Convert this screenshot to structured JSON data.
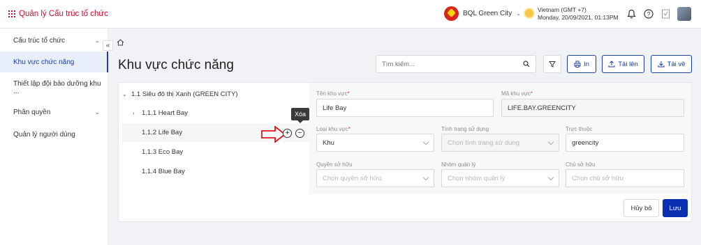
{
  "header": {
    "app_title": "Quản lý Cấu trúc tổ chức",
    "org_name": "BQL Green City",
    "timezone": "Vietnam (GMT +7)",
    "datetime": "Monday, 20/09/2021, 01:13PM"
  },
  "sidebar": {
    "items": [
      {
        "label": "Cấu trúc tổ chức",
        "has_chevron": true
      },
      {
        "label": "Khu vực chức năng",
        "active": true
      },
      {
        "label": "Thiết lập đội bảo dưỡng khu ..."
      },
      {
        "label": "Phân quyền",
        "has_chevron": true
      },
      {
        "label": "Quản lý người dùng"
      }
    ]
  },
  "main": {
    "page_title": "Khu vực chức năng",
    "search_placeholder": "Tìm kiếm...",
    "buttons": {
      "print": "In",
      "upload": "Tải lên",
      "download": "Tải về"
    }
  },
  "tree": {
    "root": "1.1 Siêu đô thị Xanh (GREEN CITY)",
    "children": [
      {
        "label": "1.1.1 Heart Bay",
        "expandable": true
      },
      {
        "label": "1.1.2 Life Bay",
        "selected": true
      },
      {
        "label": "1.1.3 Eco Bay"
      },
      {
        "label": "1.1.4 Blue Bay"
      }
    ],
    "tooltip": "Xóa"
  },
  "form": {
    "name_label": "Tên khu vực",
    "name_value": "Life Bay",
    "code_label": "Mã khu vực",
    "code_value": "LIFE.BAY.GREENCITY",
    "type_label": "Loại khu vực",
    "type_value": "Khu",
    "status_label": "Tình trạng sử dụng",
    "status_placeholder": "Chọn tình trạng sử dụng",
    "parent_label": "Trực thuộc",
    "parent_value": "greencity",
    "ownership_label": "Quyền sở hữu",
    "ownership_placeholder": "Chọn quyền sở hữu",
    "group_label": "Nhóm quản lý",
    "group_placeholder": "Chọn nhóm quản lý",
    "owner_label": "Chủ sở hữu",
    "owner_placeholder": "Chọn chủ sở hữu",
    "cancel": "Hủy bỏ",
    "save": "Lưu"
  },
  "colors": {
    "accent": "#1a3fa8",
    "brand_red": "#c8102e",
    "primary_button": "#0a2fb0"
  }
}
